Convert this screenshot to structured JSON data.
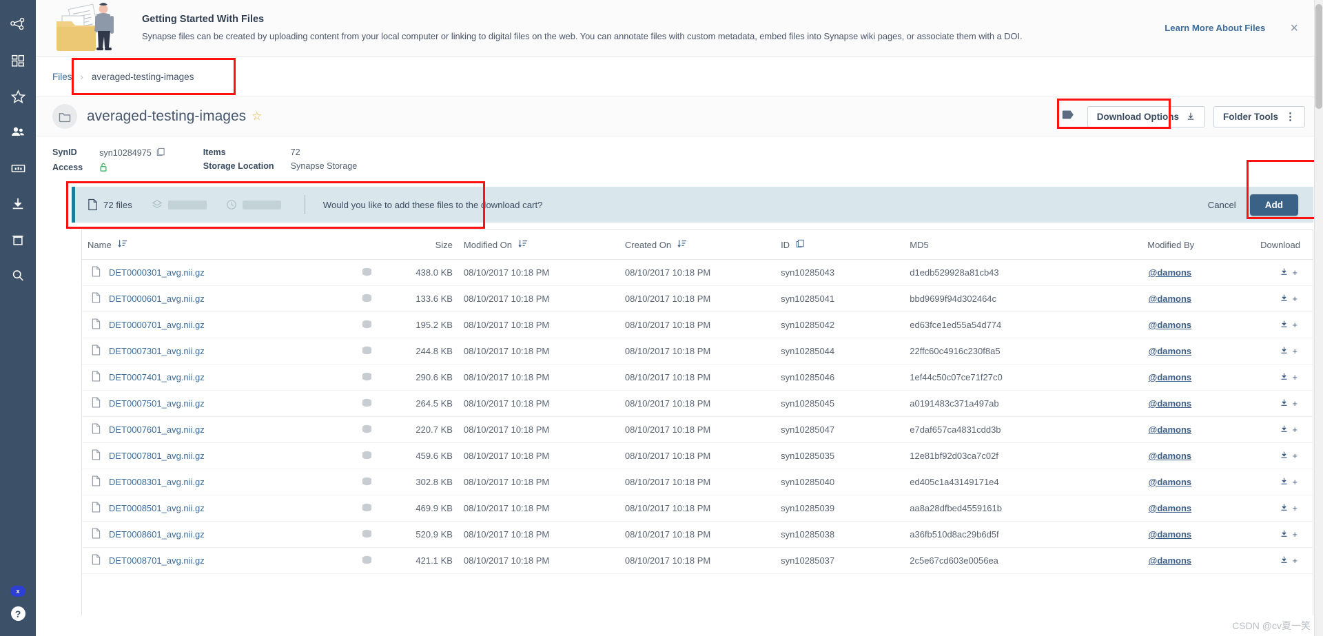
{
  "sidebar": {
    "items": [
      {
        "name": "network-icon",
        "label": "Projects Network"
      },
      {
        "name": "dashboard-icon",
        "label": "Dashboard"
      },
      {
        "name": "star-icon",
        "label": "Favorites"
      },
      {
        "name": "people-icon",
        "label": "Teams"
      },
      {
        "name": "chart-icon",
        "label": "Tables"
      },
      {
        "name": "download-icon",
        "label": "Download Cart"
      },
      {
        "name": "trash-icon",
        "label": "Trash"
      },
      {
        "name": "search-icon",
        "label": "Search"
      }
    ],
    "bottom": [
      {
        "name": "close-pill-icon",
        "label": "x"
      },
      {
        "name": "help-icon",
        "label": "?"
      }
    ]
  },
  "promo": {
    "title": "Getting Started With Files",
    "description": "Synapse files can be created by uploading content from your local computer or linking to digital files on the web. You can annotate files with custom metadata, embed files into Synapse wiki pages, or associate them with a DOI.",
    "link_label": "Learn More About Files",
    "close_label": "×"
  },
  "breadcrumb": {
    "root_label": "Files",
    "separator": "›",
    "current_label": "averaged-testing-images"
  },
  "folder_header": {
    "title": "averaged-testing-images",
    "star_label": "☆",
    "download_options_label": "Download Options",
    "folder_tools_label": "Folder Tools",
    "folder_tools_kebab": "⋮"
  },
  "meta": {
    "synid_label": "SynID",
    "synid_value": "syn10284975",
    "access_label": "Access",
    "items_label": "Items",
    "items_value": "72",
    "storage_label": "Storage Location",
    "storage_value": "Synapse Storage"
  },
  "cart": {
    "files_count_label": "72 files",
    "question": "Would you like to add these files to the download cart?",
    "cancel_label": "Cancel",
    "add_label": "Add"
  },
  "table": {
    "columns": [
      {
        "key": "name",
        "label": "Name",
        "sortable": true
      },
      {
        "key": "globe",
        "label": "",
        "sortable": false
      },
      {
        "key": "size",
        "label": "Size",
        "sortable": false
      },
      {
        "key": "modified_on",
        "label": "Modified On",
        "sortable": true
      },
      {
        "key": "created_on",
        "label": "Created On",
        "sortable": true
      },
      {
        "key": "id",
        "label": "ID",
        "sortable": false,
        "copy": true
      },
      {
        "key": "md5",
        "label": "MD5",
        "sortable": false
      },
      {
        "key": "modified_by",
        "label": "Modified By",
        "sortable": false
      },
      {
        "key": "download",
        "label": "Download",
        "sortable": false
      }
    ],
    "rows": [
      {
        "name": "DET0000301_avg.nii.gz",
        "size": "438.0 KB",
        "modified_on": "08/10/2017 10:18 PM",
        "created_on": "08/10/2017 10:18 PM",
        "id": "syn10285043",
        "md5": "d1edb529928a81cb43",
        "modified_by": "@damons"
      },
      {
        "name": "DET0000601_avg.nii.gz",
        "size": "133.6 KB",
        "modified_on": "08/10/2017 10:18 PM",
        "created_on": "08/10/2017 10:18 PM",
        "id": "syn10285041",
        "md5": "bbd9699f94d302464c",
        "modified_by": "@damons"
      },
      {
        "name": "DET0000701_avg.nii.gz",
        "size": "195.2 KB",
        "modified_on": "08/10/2017 10:18 PM",
        "created_on": "08/10/2017 10:18 PM",
        "id": "syn10285042",
        "md5": "ed63fce1ed55a54d774",
        "modified_by": "@damons"
      },
      {
        "name": "DET0007301_avg.nii.gz",
        "size": "244.8 KB",
        "modified_on": "08/10/2017 10:18 PM",
        "created_on": "08/10/2017 10:18 PM",
        "id": "syn10285044",
        "md5": "22ffc60c4916c230f8a5",
        "modified_by": "@damons"
      },
      {
        "name": "DET0007401_avg.nii.gz",
        "size": "290.6 KB",
        "modified_on": "08/10/2017 10:18 PM",
        "created_on": "08/10/2017 10:18 PM",
        "id": "syn10285046",
        "md5": "1ef44c50c07ce71f27c0",
        "modified_by": "@damons"
      },
      {
        "name": "DET0007501_avg.nii.gz",
        "size": "264.5 KB",
        "modified_on": "08/10/2017 10:18 PM",
        "created_on": "08/10/2017 10:18 PM",
        "id": "syn10285045",
        "md5": "a0191483c371a497ab",
        "modified_by": "@damons"
      },
      {
        "name": "DET0007601_avg.nii.gz",
        "size": "220.7 KB",
        "modified_on": "08/10/2017 10:18 PM",
        "created_on": "08/10/2017 10:18 PM",
        "id": "syn10285047",
        "md5": "e7daf657ca4831cdd3b",
        "modified_by": "@damons"
      },
      {
        "name": "DET0007801_avg.nii.gz",
        "size": "459.6 KB",
        "modified_on": "08/10/2017 10:18 PM",
        "created_on": "08/10/2017 10:18 PM",
        "id": "syn10285035",
        "md5": "12e81bf92d03ca7c02f",
        "modified_by": "@damons"
      },
      {
        "name": "DET0008301_avg.nii.gz",
        "size": "302.8 KB",
        "modified_on": "08/10/2017 10:18 PM",
        "created_on": "08/10/2017 10:18 PM",
        "id": "syn10285040",
        "md5": "ed405c1a43149171e4",
        "modified_by": "@damons"
      },
      {
        "name": "DET0008501_avg.nii.gz",
        "size": "469.9 KB",
        "modified_on": "08/10/2017 10:18 PM",
        "created_on": "08/10/2017 10:18 PM",
        "id": "syn10285039",
        "md5": "aa8a28dfbed4559161b",
        "modified_by": "@damons"
      },
      {
        "name": "DET0008601_avg.nii.gz",
        "size": "520.9 KB",
        "modified_on": "08/10/2017 10:18 PM",
        "created_on": "08/10/2017 10:18 PM",
        "id": "syn10285038",
        "md5": "a36fb510d8ac29b6d5f",
        "modified_by": "@damons"
      },
      {
        "name": "DET0008701_avg.nii.gz",
        "size": "421.1 KB",
        "modified_on": "08/10/2017 10:18 PM",
        "created_on": "08/10/2017 10:18 PM",
        "id": "syn10285037",
        "md5": "2c5e67cd603e0056ea",
        "modified_by": "@damons"
      }
    ],
    "download_plus": "+"
  },
  "watermark": "CSDN @cv夏一笑",
  "colors": {
    "sidebar_bg": "#3c5068",
    "accent_link": "#3c6c9b",
    "highlight_box": "#fb1110",
    "cart_bg": "#d9e7ec",
    "cart_rule": "#1b7d99",
    "add_button": "#3a6287"
  }
}
